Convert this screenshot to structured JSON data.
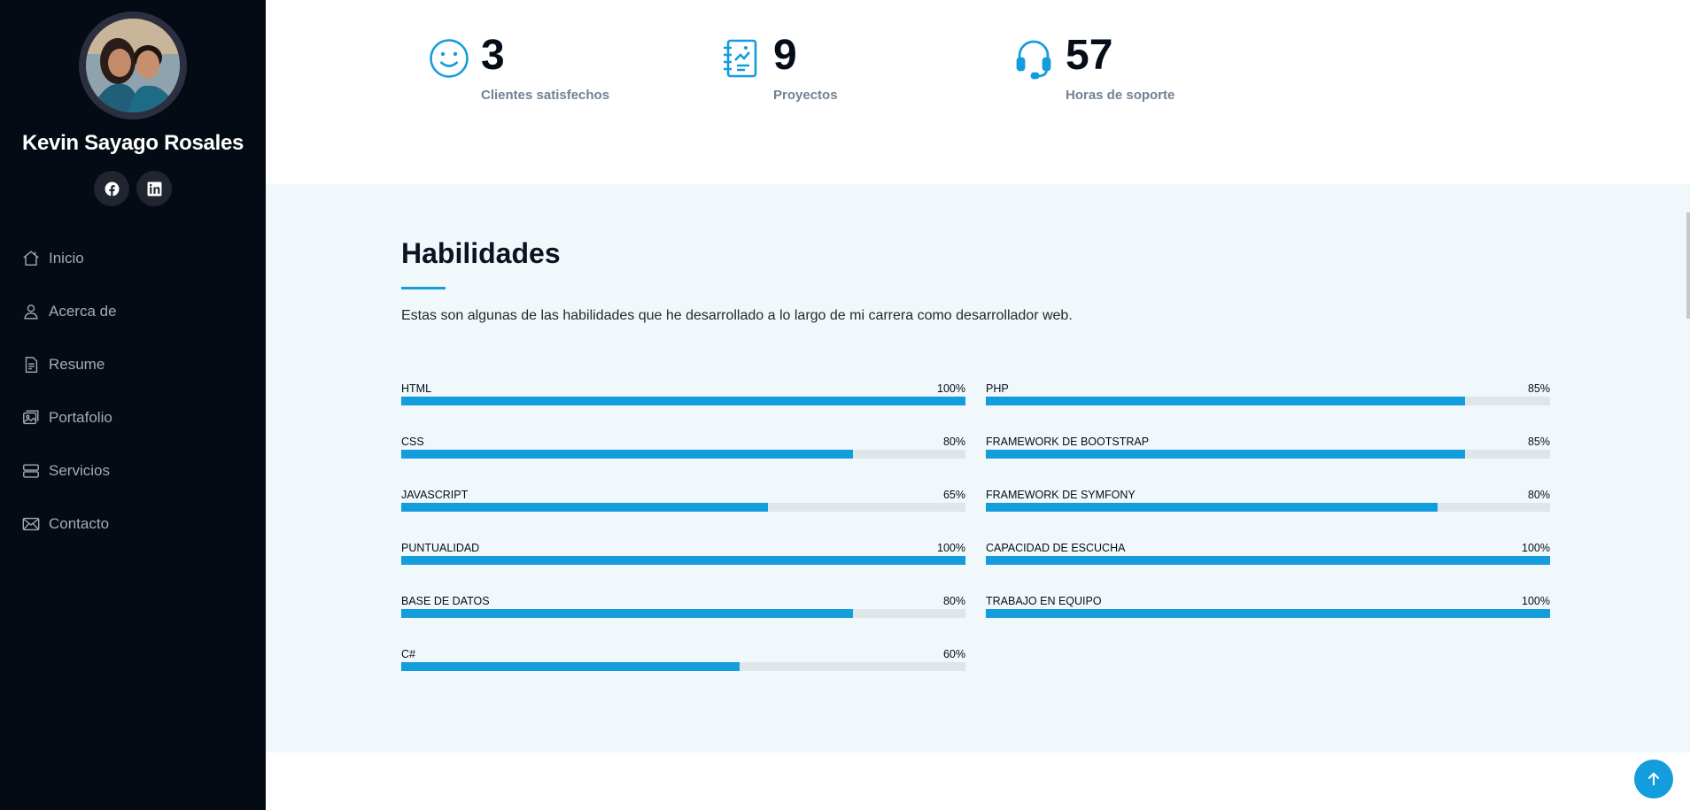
{
  "profile": {
    "name": "Kevin Sayago Rosales"
  },
  "social": [
    {
      "icon": "facebook-icon"
    },
    {
      "icon": "linkedin-icon"
    }
  ],
  "nav": [
    {
      "label": "Inicio",
      "icon": "home-icon"
    },
    {
      "label": "Acerca de",
      "icon": "person-icon"
    },
    {
      "label": "Resume",
      "icon": "file-text-icon"
    },
    {
      "label": "Portafolio",
      "icon": "images-icon"
    },
    {
      "label": "Servicios",
      "icon": "server-icon"
    },
    {
      "label": "Contacto",
      "icon": "envelope-icon"
    }
  ],
  "counts": [
    {
      "value": "3",
      "label": "Clientes satisfechos",
      "icon": "smile-icon"
    },
    {
      "value": "9",
      "label": "Proyectos",
      "icon": "journal-richtext-icon"
    },
    {
      "value": "57",
      "label": "Horas de soporte",
      "icon": "headset-icon"
    }
  ],
  "skills_section": {
    "title": "Habilidades",
    "description": "Estas son algunas de las habilidades que he desarrollado a lo largo de mi carrera como desarrollador web."
  },
  "skills_left": [
    {
      "name": "HTML",
      "value_label": "100%",
      "percent": 100
    },
    {
      "name": "CSS",
      "value_label": "80%",
      "percent": 80
    },
    {
      "name": "JAVASCRIPT",
      "value_label": "65%",
      "percent": 65
    },
    {
      "name": "PUNTUALIDAD",
      "value_label": "100%",
      "percent": 100
    },
    {
      "name": "BASE DE DATOS",
      "value_label": "80%",
      "percent": 80
    },
    {
      "name": "C#",
      "value_label": "60%",
      "percent": 60
    }
  ],
  "skills_right": [
    {
      "name": "PHP",
      "value_label": "85%",
      "percent": 85
    },
    {
      "name": "FRAMEWORK DE BOOTSTRAP",
      "value_label": "85%",
      "percent": 85
    },
    {
      "name": "FRAMEWORK DE SYMFONY",
      "value_label": "80%",
      "percent": 80
    },
    {
      "name": "CAPACIDAD DE ESCUCHA",
      "value_label": "100%",
      "percent": 100
    },
    {
      "name": "TRABAJO EN EQUIPO",
      "value_label": "100%",
      "percent": 100
    }
  ],
  "colors": {
    "accent": "#149ddd",
    "sidebar_bg": "#040b14",
    "track": "#dfe6ea"
  },
  "back_to_top": {
    "icon": "arrow-up-icon"
  }
}
